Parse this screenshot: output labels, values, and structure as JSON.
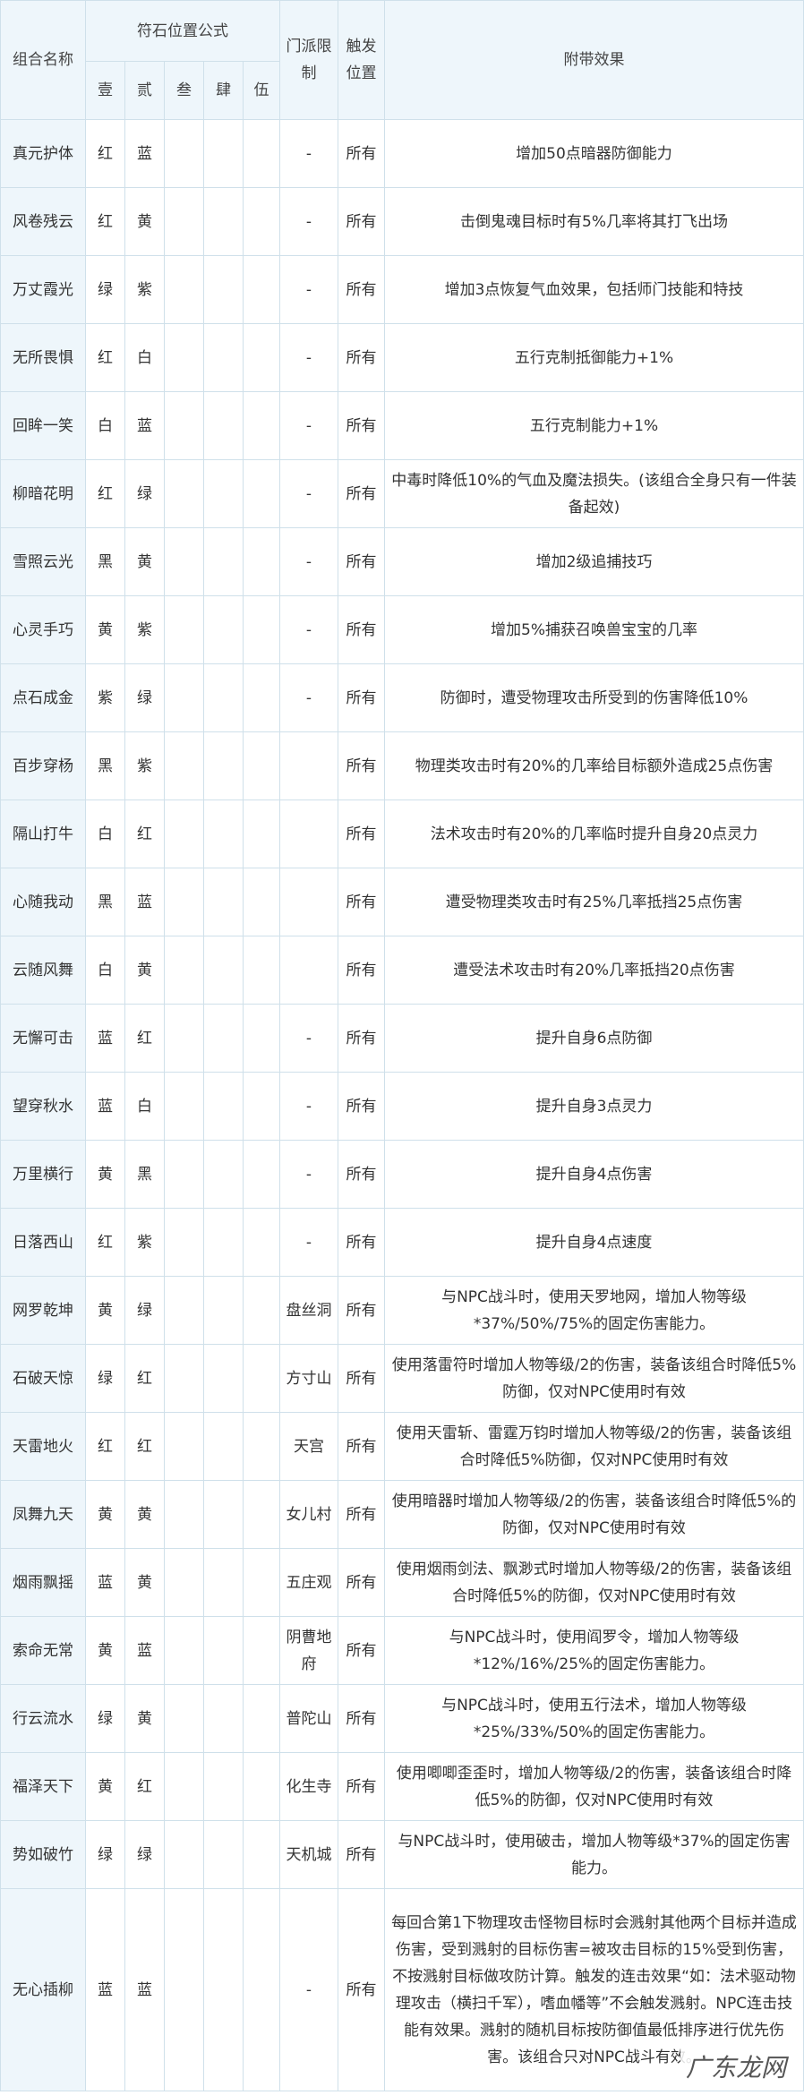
{
  "headers": {
    "name": "组合名称",
    "formula": "符石位置公式",
    "positions": [
      "壹",
      "贰",
      "叁",
      "肆",
      "伍"
    ],
    "sect": "门派限制",
    "trigger": "触发位置",
    "effect": "附带效果"
  },
  "rows": [
    {
      "name": "真元护体",
      "p1": "红",
      "p2": "蓝",
      "sect": "-",
      "trigger": "所有",
      "effect": "增加50点暗器防御能力"
    },
    {
      "name": "风卷残云",
      "p1": "红",
      "p2": "黄",
      "sect": "-",
      "trigger": "所有",
      "effect": "击倒鬼魂目标时有5%几率将其打飞出场"
    },
    {
      "name": "万丈霞光",
      "p1": "绿",
      "p2": "紫",
      "sect": "-",
      "trigger": "所有",
      "effect": "增加3点恢复气血效果，包括师门技能和特技"
    },
    {
      "name": "无所畏惧",
      "p1": "红",
      "p2": "白",
      "sect": "-",
      "trigger": "所有",
      "effect": "五行克制抵御能力+1%"
    },
    {
      "name": "回眸一笑",
      "p1": "白",
      "p2": "蓝",
      "sect": "-",
      "trigger": "所有",
      "effect": "五行克制能力+1%"
    },
    {
      "name": "柳暗花明",
      "p1": "红",
      "p2": "绿",
      "sect": "-",
      "trigger": "所有",
      "effect": "中毒时降低10%的气血及魔法损失。(该组合全身只有一件装备起效)"
    },
    {
      "name": "雪照云光",
      "p1": "黑",
      "p2": "黄",
      "sect": "-",
      "trigger": "所有",
      "effect": "增加2级追捕技巧"
    },
    {
      "name": "心灵手巧",
      "p1": "黄",
      "p2": "紫",
      "sect": "-",
      "trigger": "所有",
      "effect": "增加5%捕获召唤兽宝宝的几率"
    },
    {
      "name": "点石成金",
      "p1": "紫",
      "p2": "绿",
      "sect": "-",
      "trigger": "所有",
      "effect": "防御时，遭受物理攻击所受到的伤害降低10%"
    },
    {
      "name": "百步穿杨",
      "p1": "黑",
      "p2": "紫",
      "sect": "",
      "trigger": "所有",
      "effect": "物理类攻击时有20%的几率给目标额外造成25点伤害"
    },
    {
      "name": "隔山打牛",
      "p1": "白",
      "p2": "红",
      "sect": "",
      "trigger": "所有",
      "effect": "法术攻击时有20%的几率临时提升自身20点灵力"
    },
    {
      "name": "心随我动",
      "p1": "黑",
      "p2": "蓝",
      "sect": "",
      "trigger": "所有",
      "effect": "遭受物理类攻击时有25%几率抵挡25点伤害"
    },
    {
      "name": "云随风舞",
      "p1": "白",
      "p2": "黄",
      "sect": "",
      "trigger": "所有",
      "effect": "遭受法术攻击时有20%几率抵挡20点伤害"
    },
    {
      "name": "无懈可击",
      "p1": "蓝",
      "p2": "红",
      "sect": "-",
      "trigger": "所有",
      "effect": "提升自身6点防御"
    },
    {
      "name": "望穿秋水",
      "p1": "蓝",
      "p2": "白",
      "sect": "-",
      "trigger": "所有",
      "effect": "提升自身3点灵力"
    },
    {
      "name": "万里横行",
      "p1": "黄",
      "p2": "黑",
      "sect": "-",
      "trigger": "所有",
      "effect": "提升自身4点伤害"
    },
    {
      "name": "日落西山",
      "p1": "红",
      "p2": "紫",
      "sect": "-",
      "trigger": "所有",
      "effect": "提升自身4点速度"
    },
    {
      "name": "网罗乾坤",
      "p1": "黄",
      "p2": "绿",
      "sect": "盘丝洞",
      "trigger": "所有",
      "effect": "与NPC战斗时，使用天罗地网，增加人物等级*37%/50%/75%的固定伤害能力。"
    },
    {
      "name": "石破天惊",
      "p1": "绿",
      "p2": "红",
      "sect": "方寸山",
      "trigger": "所有",
      "effect": "使用落雷符时增加人物等级/2的伤害，装备该组合时降低5%防御，仅对NPC使用时有效"
    },
    {
      "name": "天雷地火",
      "p1": "红",
      "p2": "红",
      "sect": "天宫",
      "trigger": "所有",
      "effect": "使用天雷斩、雷霆万钧时增加人物等级/2的伤害，装备该组合时降低5%防御，仅对NPC使用时有效"
    },
    {
      "name": "凤舞九天",
      "p1": "黄",
      "p2": "黄",
      "sect": "女儿村",
      "trigger": "所有",
      "effect": "使用暗器时增加人物等级/2的伤害，装备该组合时降低5%的防御，仅对NPC使用时有效"
    },
    {
      "name": "烟雨飘摇",
      "p1": "蓝",
      "p2": "黄",
      "sect": "五庄观",
      "trigger": "所有",
      "effect": "使用烟雨剑法、飘渺式时增加人物等级/2的伤害，装备该组合时降低5%的防御，仅对NPC使用时有效"
    },
    {
      "name": "索命无常",
      "p1": "黄",
      "p2": "蓝",
      "sect": "阴曹地府",
      "trigger": "所有",
      "effect": "与NPC战斗时，使用阎罗令，增加人物等级*12%/16%/25%的固定伤害能力。"
    },
    {
      "name": "行云流水",
      "p1": "绿",
      "p2": "黄",
      "sect": "普陀山",
      "trigger": "所有",
      "effect": "与NPC战斗时，使用五行法术，增加人物等级*25%/33%/50%的固定伤害能力。"
    },
    {
      "name": "福泽天下",
      "p1": "黄",
      "p2": "红",
      "sect": "化生寺",
      "trigger": "所有",
      "effect": "使用唧唧歪歪时，增加人物等级/2的伤害，装备该组合时降低5%的防御，仅对NPC使用时有效"
    },
    {
      "name": "势如破竹",
      "p1": "绿",
      "p2": "绿",
      "sect": "天机城",
      "trigger": "所有",
      "effect": "与NPC战斗时，使用破击，增加人物等级*37%的固定伤害能力。"
    },
    {
      "name": "无心插柳",
      "p1": "蓝",
      "p2": "蓝",
      "sect": "-",
      "trigger": "所有",
      "effect": "每回合第1下物理攻击怪物目标时会溅射其他两个目标并造成伤害，受到溅射的目标伤害=被攻击目标的15%受到伤害，不按溅射目标做攻防计算。触发的连击效果“如：法术驱动物理攻击（横扫千军），嗜血幡等”不会触发溅射。NPC连击技能有效果。溅射的随机目标按防御值最低排序进行优先伤害。该组合只对NPC战斗有效。"
    }
  ],
  "watermark": "广东龙网"
}
